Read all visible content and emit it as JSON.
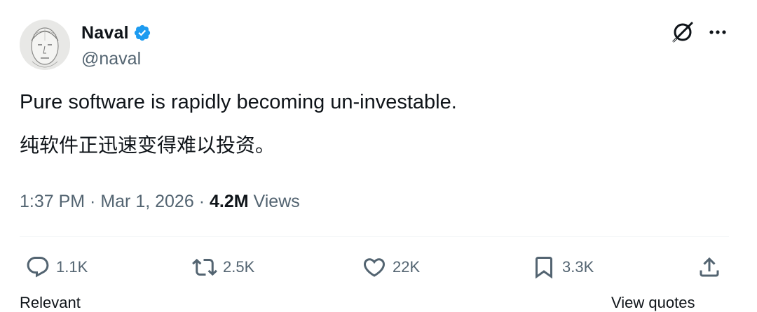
{
  "author": {
    "display_name": "Naval",
    "handle": "@naval",
    "verified": true,
    "avatar": "sketch-portrait"
  },
  "tweet": {
    "text_en": "Pure software is rapidly becoming un-investable.",
    "text_zh": "纯软件正迅速变得难以投资。"
  },
  "meta": {
    "time": "1:37 PM",
    "separator": " · ",
    "date": "Mar 1, 2026",
    "views_count": "4.2M",
    "views_label": " Views"
  },
  "actions": {
    "reply_count": "1.1K",
    "repost_count": "2.5K",
    "like_count": "22K",
    "bookmark_count": "3.3K"
  },
  "icons": {
    "verified": "verified-badge-icon",
    "grok": "grok-icon",
    "more": "more-icon",
    "reply": "reply-icon",
    "repost": "repost-icon",
    "like": "heart-icon",
    "bookmark": "bookmark-icon",
    "share": "share-icon"
  },
  "colors": {
    "text": "#0f1419",
    "secondary": "#536471",
    "verified": "#1d9bf0",
    "divider": "#eff3f4"
  },
  "cut_off": {
    "left": "Relevant",
    "right": "View quotes"
  }
}
